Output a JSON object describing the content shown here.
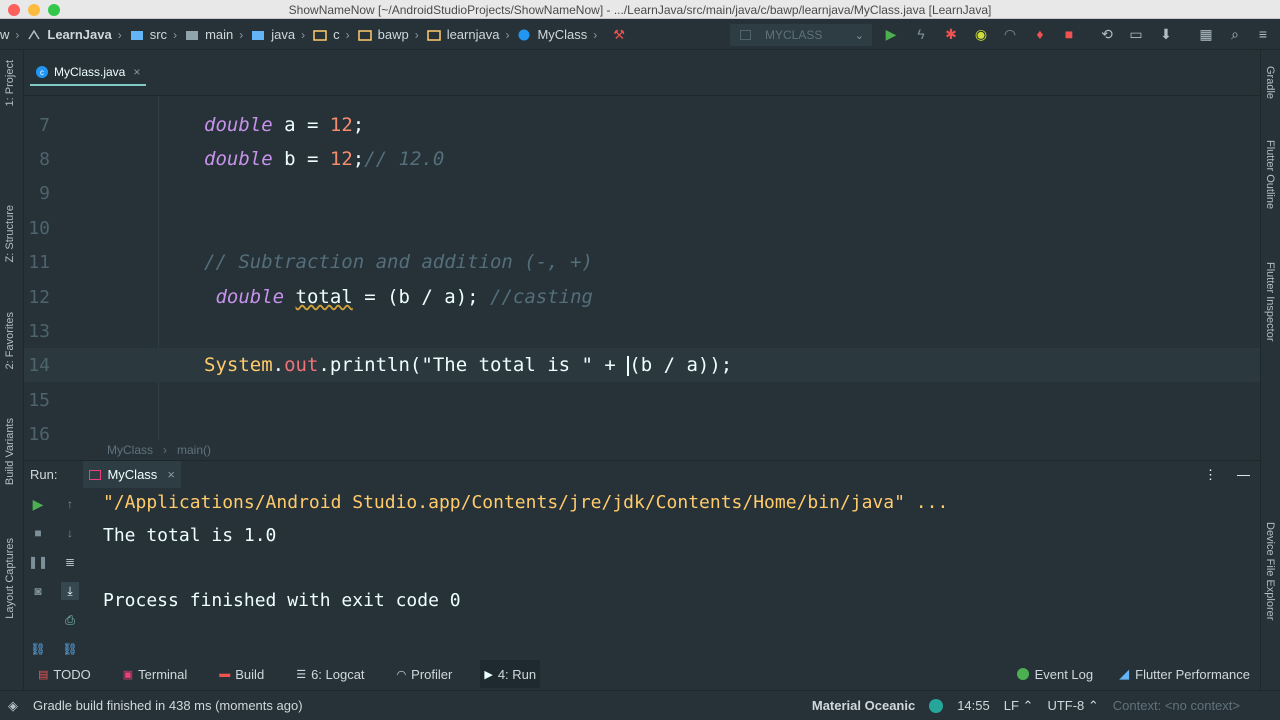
{
  "window": {
    "title": "ShowNameNow [~/AndroidStudioProjects/ShowNameNow] - .../LearnJava/src/main/java/c/bawp/learnjava/MyClass.java [LearnJava]"
  },
  "breadcrumbs": [
    {
      "label": "w",
      "icon": "folder-icon"
    },
    {
      "label": "LearnJava",
      "icon": "module-icon"
    },
    {
      "label": "src",
      "icon": "folder-icon"
    },
    {
      "label": "main",
      "icon": "folder-icon"
    },
    {
      "label": "java",
      "icon": "folder-icon"
    },
    {
      "label": "c",
      "icon": "package-icon"
    },
    {
      "label": "bawp",
      "icon": "package-icon"
    },
    {
      "label": "learnjava",
      "icon": "package-icon"
    },
    {
      "label": "MyClass",
      "icon": "class-icon"
    }
  ],
  "run_config": {
    "label": "MYCLASS"
  },
  "left_tools": {
    "project": "1: Project",
    "structure": "Z: Structure",
    "favorites": "2: Favorites",
    "build_variants": "Build Variants",
    "layout_captures": "Layout Captures"
  },
  "right_tools": {
    "gradle": "Gradle",
    "flutter_outline": "Flutter Outline",
    "flutter_inspector": "Flutter Inspector",
    "device_file_explorer": "Device File Explorer"
  },
  "editor": {
    "tab": "MyClass.java",
    "line_numbers": [
      "7",
      "8",
      "9",
      "10",
      "11",
      "12",
      "13",
      "14",
      "15",
      "16"
    ],
    "breadcrumb": {
      "class": "MyClass",
      "method": "main()"
    }
  },
  "run": {
    "label": "Run:",
    "tab": "MyClass",
    "output": [
      "\"/Applications/Android Studio.app/Contents/jre/jdk/Contents/Home/bin/java\" ...",
      "The total is 1.0",
      "",
      "Process finished with exit code 0"
    ]
  },
  "tool_windows": [
    {
      "label": "TODO",
      "icon": "todo-icon"
    },
    {
      "label": "Terminal",
      "icon": "terminal-icon"
    },
    {
      "label": "Build",
      "icon": "build-icon"
    },
    {
      "label": "6: Logcat",
      "icon": "logcat-icon"
    },
    {
      "label": "Profiler",
      "icon": "profiler-icon"
    },
    {
      "label": "4: Run",
      "icon": "run-icon"
    }
  ],
  "right_tool_windows": {
    "event_log": "Event Log",
    "flutter_performance": "Flutter Performance"
  },
  "status": {
    "message": "Gradle build finished in 438 ms (moments ago)",
    "theme": "Material Oceanic",
    "position": "14:55",
    "line_sep": "LF",
    "encoding": "UTF-8",
    "context": "Context: <no context>"
  },
  "colors": {
    "keyword": "#c792ea",
    "number": "#f78c6c",
    "comment": "#546e7a",
    "class": "#ffcb6b",
    "field": "#f07178",
    "accent": "#80cbc4"
  }
}
